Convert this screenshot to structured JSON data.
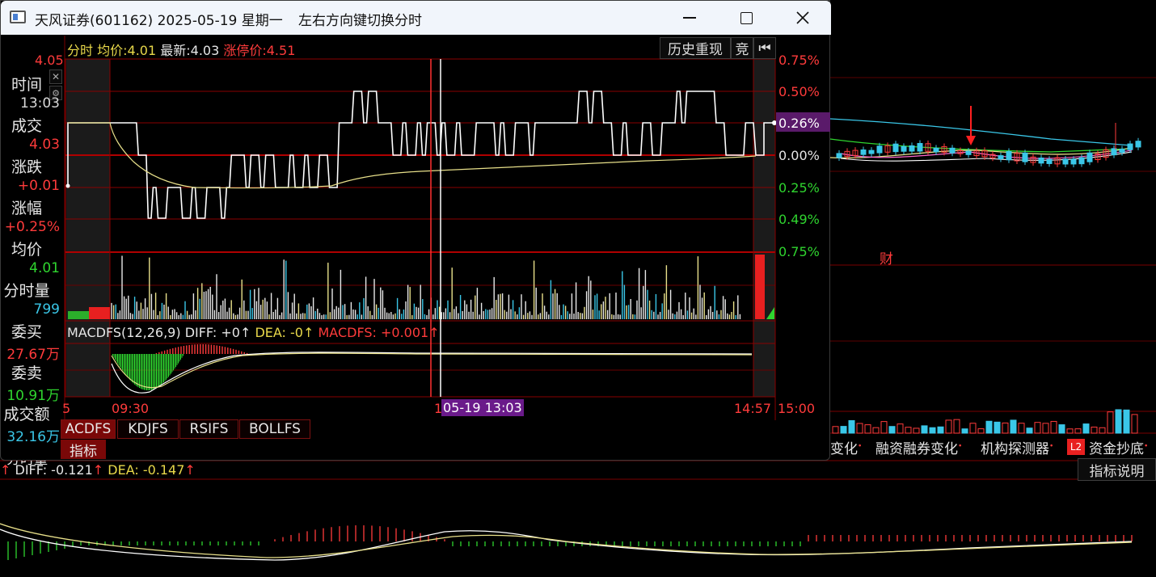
{
  "window": {
    "title": "天风证券(601162) 2025-05-19 星期一",
    "hint": "左右方向键切换分时"
  },
  "header": {
    "mode": "分时",
    "avg_label": "均价:",
    "avg_value": "4.01",
    "latest_label": "最新:",
    "latest_value": "4.03",
    "limit_label": "涨停价:4.51",
    "history_button": "历史重现",
    "auction_button": "竞",
    "top_price": "4.05"
  },
  "info_panel": [
    {
      "label": "时间",
      "value": "13:03",
      "label_color": "#e6e6e6",
      "value_color": "#d8d8d8"
    },
    {
      "label": "成交",
      "value": "4.03",
      "label_color": "#e6e6e6",
      "value_color": "#ff3b3b"
    },
    {
      "label": "涨跌",
      "value": "+0.01",
      "label_color": "#e6e6e6",
      "value_color": "#ff3b3b"
    },
    {
      "label": "涨幅",
      "value": "+0.25%",
      "label_color": "#e6e6e6",
      "value_color": "#ff3b3b"
    },
    {
      "label": "均价",
      "value": "4.01",
      "label_color": "#e6e6e6",
      "value_color": "#2fd52f"
    },
    {
      "label": "分时量",
      "value": "799",
      "label_color": "#e6e6e6",
      "value_color": "#3ac7e8"
    },
    {
      "label": "委买",
      "value": "27.67万",
      "label_color": "#e6e6e6",
      "value_color": "#ff3b3b"
    },
    {
      "label": "委卖",
      "value": "10.91万",
      "label_color": "#e6e6e6",
      "value_color": "#2fd52f"
    },
    {
      "label": "成交额",
      "value": "32.16万",
      "label_color": "#e6e6e6",
      "value_color": "#3ac7e8"
    }
  ],
  "right_axis": [
    {
      "label": "0.75%",
      "color": "#ff3b3b"
    },
    {
      "label": "0.50%",
      "color": "#ff3b3b"
    },
    {
      "label": "0.26%",
      "color": "#ffffff"
    },
    {
      "label": "0.00%",
      "color": "#e6e6e6"
    },
    {
      "label": "0.25%",
      "color": "#2fd52f"
    },
    {
      "label": "0.49%",
      "color": "#2fd52f"
    },
    {
      "label": "0.75%",
      "color": "#2fd52f"
    }
  ],
  "indicator": {
    "name": "MACDFS(12,26,9)",
    "diff": "DIFF: +0↑",
    "dea": "DEA: -0↑",
    "macd": "MACDFS: +0.001↑"
  },
  "time_axis": {
    "t_start": "5",
    "t_open": "09:30",
    "t_mark": "1",
    "cursor_label": "05-19 13:03",
    "t_last": "14:57",
    "t_close": "15:00"
  },
  "tabs": [
    "ACDFS",
    "KDJFS",
    "RSIFS",
    "BOLLFS"
  ],
  "indicator_tab": "指标",
  "background": {
    "cai_label": "财",
    "partial_label": "分时量",
    "bottom_diff": "DIFF: -0.121",
    "bottom_dea": "DEA: -0.147",
    "right_tabs": [
      "变化",
      "融资融券变化",
      "机构探测器",
      "L2",
      "资金抄底"
    ],
    "indicator_help": "指标说明"
  },
  "colors": {
    "up": "#ff3b3b",
    "down": "#2fd52f",
    "cyan": "#3ac7e8",
    "avg_line": "#e8e08a",
    "grid": "#8a0000"
  }
}
